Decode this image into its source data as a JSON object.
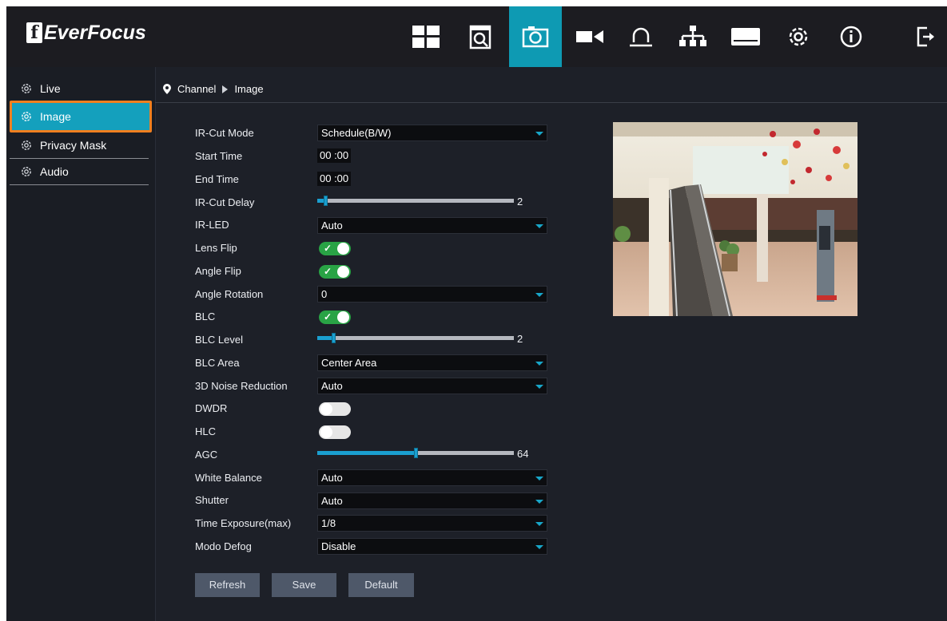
{
  "brand": {
    "logo_text": "EverFocus"
  },
  "nav": {
    "icons": [
      "dashboard-icon",
      "playback-icon",
      "image-settings-icon",
      "camera-record-icon",
      "alarm-icon",
      "network-icon",
      "storage-icon",
      "settings-gear-icon",
      "info-icon",
      "logout-icon"
    ],
    "active": "image-settings-icon",
    "accent": "#0e9ab3"
  },
  "sidebar": {
    "items": [
      {
        "label": "Live"
      },
      {
        "label": "Image"
      },
      {
        "label": "Privacy Mask"
      },
      {
        "label": "Audio"
      }
    ],
    "active_index": 1,
    "highlight_border": "#f07f1f"
  },
  "breadcrumb": {
    "parent": "Channel",
    "current": "Image"
  },
  "form": {
    "ir_cut_mode": {
      "label": "IR-Cut Mode",
      "value": "Schedule(B/W)"
    },
    "start_time": {
      "label": "Start Time",
      "value": "00 :00"
    },
    "end_time": {
      "label": "End Time",
      "value": "00 :00"
    },
    "ir_cut_delay": {
      "label": "IR-Cut Delay",
      "value": "2",
      "fill": 0.04
    },
    "ir_led": {
      "label": "IR-LED",
      "value": "Auto"
    },
    "lens_flip": {
      "label": "Lens Flip",
      "on": true
    },
    "angle_flip": {
      "label": "Angle Flip",
      "on": true
    },
    "angle_rotation": {
      "label": "Angle Rotation",
      "value": "0"
    },
    "blc": {
      "label": "BLC",
      "on": true
    },
    "blc_level": {
      "label": "BLC Level",
      "value": "2",
      "fill": 0.08
    },
    "blc_area": {
      "label": "BLC Area",
      "value": "Center Area"
    },
    "noise_reduction": {
      "label": "3D Noise Reduction",
      "value": "Auto"
    },
    "dwdr": {
      "label": "DWDR",
      "on": false
    },
    "hlc": {
      "label": "HLC",
      "on": false
    },
    "agc": {
      "label": "AGC",
      "value": "64",
      "fill": 0.5
    },
    "white_balance": {
      "label": "White Balance",
      "value": "Auto"
    },
    "shutter": {
      "label": "Shutter",
      "value": "Auto"
    },
    "time_exposure": {
      "label": "Time Exposure(max)",
      "value": "1/8"
    },
    "modo_defog": {
      "label": "Modo Defog",
      "value": "Disable"
    }
  },
  "buttons": {
    "refresh": "Refresh",
    "save": "Save",
    "default": "Default"
  }
}
